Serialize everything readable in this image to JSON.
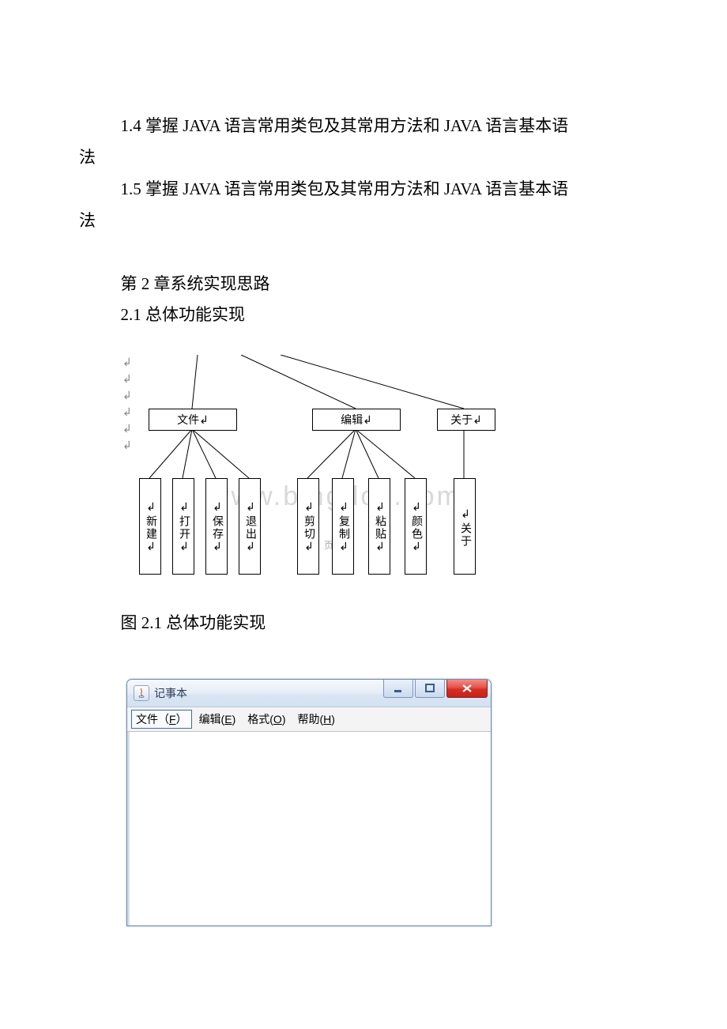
{
  "text": {
    "p1": "1.4 掌握 JAVA 语言常用类包及其常用方法和 JAVA 语言基本语",
    "p1_cont": "法",
    "p2": "1.5 掌握 JAVA 语言常用类包及其常用方法和 JAVA 语言基本语",
    "p2_cont": "法",
    "chapter2": "第 2 章系统实现思路",
    "section21": "2.1 总体功能实现",
    "caption": "图 2.1 总体功能实现"
  },
  "diagram": {
    "crlf": "↲",
    "mid": {
      "file": "文件↲",
      "edit": "编辑↲",
      "about": "关于↲"
    },
    "leaf": {
      "new": "↲新建↲",
      "open": "↲打开↲",
      "save": "↲保存↲",
      "exit": "↲退出↲",
      "cut": "↲剪切↲",
      "copy": "↲复制↲",
      "paste": "↲粘贴↲",
      "color": "↲颜色↲",
      "aboutleaf": "↲关于"
    },
    "footnote": "页",
    "watermark": "www.bingdoc.com"
  },
  "notepad": {
    "title": "记事本",
    "menu": {
      "file_pre": "文件（",
      "file_key": "F",
      "file_post": "）",
      "edit_pre": "编辑(",
      "edit_key": "E",
      "edit_post": ")",
      "format_pre": "格式(",
      "format_key": "O",
      "format_post": ")",
      "help_pre": "帮助(",
      "help_key": "H",
      "help_post": ")"
    }
  }
}
